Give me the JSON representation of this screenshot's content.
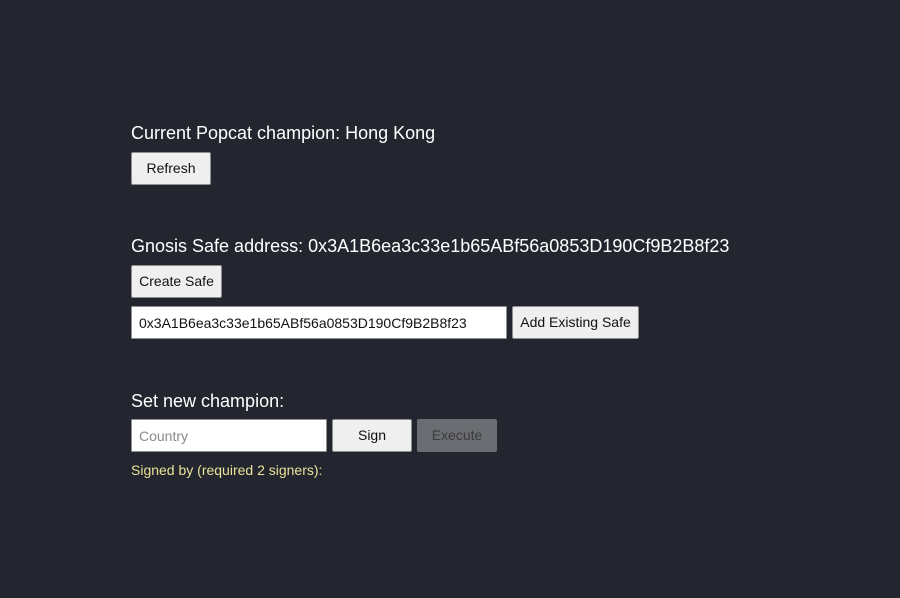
{
  "champion": {
    "label": "Current Popcat champion: Hong Kong",
    "refresh_label": "Refresh"
  },
  "safe": {
    "label": "Gnosis Safe address: 0x3A1B6ea3c33e1b65ABf56a0853D190Cf9B2B8f23",
    "create_label": "Create Safe",
    "address_input_value": "0x3A1B6ea3c33e1b65ABf56a0853D190Cf9B2B8f23",
    "add_existing_label": "Add Existing Safe"
  },
  "set_champion": {
    "label": "Set new champion:",
    "country_placeholder": "Country",
    "sign_label": "Sign",
    "execute_label": "Execute",
    "signers_text": "Signed by (required 2 signers):"
  },
  "colors": {
    "background": "#23262e",
    "signers_text": "#e8e29a"
  }
}
